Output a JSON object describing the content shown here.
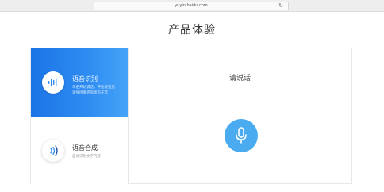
{
  "browser": {
    "url": "yuyin.baidu.com",
    "reload_icon": "reload-icon"
  },
  "page": {
    "title": "产品体验"
  },
  "sidebar": {
    "items": [
      {
        "label": "语音识别",
        "description_line1": "单击开始说话，开始说话后",
        "description_line2": "请保持麦克风状态正常",
        "icon": "audio-wave-icon",
        "active": true
      },
      {
        "label": "语音合成",
        "description": "自动识别文字内容",
        "icon": "speaker-icon",
        "active": false
      }
    ]
  },
  "main": {
    "prompt": "请说话",
    "mic_icon": "microphone-icon"
  },
  "colors": {
    "accent": "#1b74e6",
    "mic": "#4aabf0",
    "title": "#333333"
  }
}
